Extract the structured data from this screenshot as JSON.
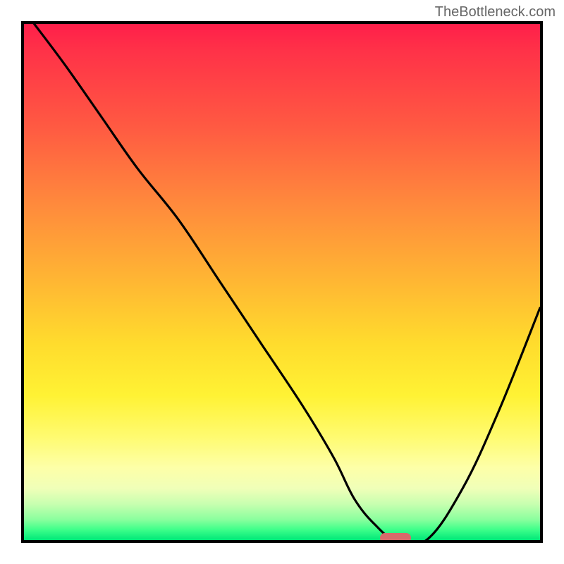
{
  "watermark": "TheBottleneck.com",
  "chart_data": {
    "type": "line",
    "title": "",
    "xlabel": "",
    "ylabel": "",
    "xlim": [
      0,
      100
    ],
    "ylim": [
      0,
      100
    ],
    "grid": false,
    "series": [
      {
        "name": "bottleneck-curve",
        "x": [
          2,
          8,
          15,
          22,
          30,
          38,
          46,
          54,
          60,
          64,
          68,
          72,
          78,
          85,
          92,
          100
        ],
        "values": [
          100,
          92,
          82,
          72,
          62,
          50,
          38,
          26,
          16,
          8,
          3,
          0,
          0,
          10,
          25,
          45
        ]
      }
    ],
    "annotations": [
      {
        "name": "optimal-marker",
        "x": 72,
        "y": 0,
        "width_pct": 6,
        "color": "#d86a6a"
      }
    ],
    "background_gradient": {
      "top": "#ff1f4a",
      "mid": "#ffdc2d",
      "bottom": "#00e878"
    }
  }
}
